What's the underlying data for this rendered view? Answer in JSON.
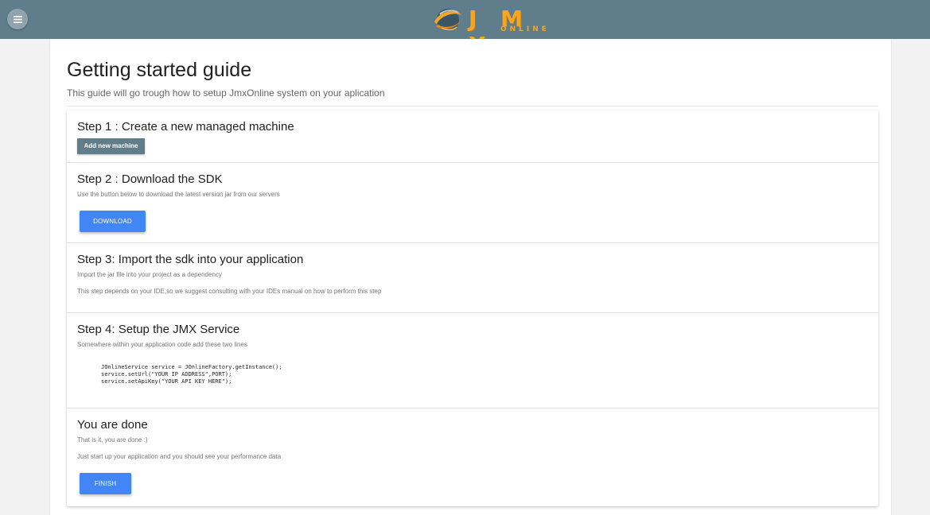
{
  "header": {
    "menu_icon": "hamburger-menu-icon",
    "logo": {
      "letters": "J M X",
      "sub": "ONLINE",
      "swirl_icon": "globe-swirl-icon",
      "accent": "#f5a623"
    },
    "color": "#607d8b"
  },
  "page": {
    "title": "Getting started guide",
    "subtitle": "This guide will go trough how to setup JmxOnline system on your aplication"
  },
  "steps": [
    {
      "title": "Step 1 : Create a new managed machine",
      "button": "Add new machine"
    },
    {
      "title": "Step 2 : Download the SDK",
      "desc": "Use the button below to download the latest version jar from our servers",
      "button": "DOWNLOAD"
    },
    {
      "title": "Step 3: Import the sdk into your application",
      "desc": "Import the jar file into your project as a dependency",
      "desc2": "This step depends on your IDE,so we suggest consulting with your IDEs manual on how to perform this step"
    },
    {
      "title": "Step 4: Setup the JMX Service",
      "desc": "Somewhere within your application code add these two lines",
      "code": "JOnlineService service = JOnlineFactory.getInstance();\nservice.setUrl(\"YOUR IP ADDRESS\",PORT);\nservice.setApiKey(\"YOUR API KEY HERE\");"
    },
    {
      "title": "You are done",
      "desc": "That is it, you are done :)",
      "desc2": "Just start up your application and you should see your performance data",
      "button": "FINISH"
    }
  ],
  "colors": {
    "primary_button": "#4285f4",
    "secondary_button": "#607d8b"
  }
}
